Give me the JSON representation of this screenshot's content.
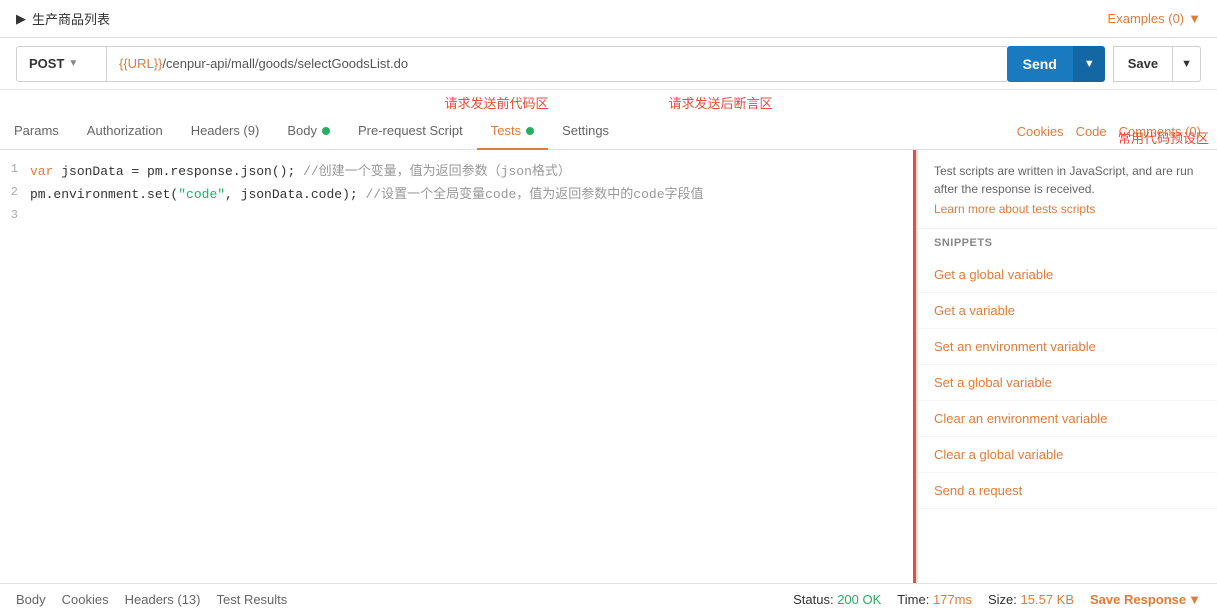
{
  "topbar": {
    "title": "生产商品列表",
    "arrow": "▶",
    "examples_label": "Examples (0)",
    "examples_chevron": "▼"
  },
  "urlbar": {
    "method": "POST",
    "method_chevron": "▼",
    "url": "{{URL}}/cenpur-api/mall/goods/selectGoodsList.do",
    "url_prefix": "{{URL}}",
    "url_suffix": "/cenpur-api/mall/goods/selectGoodsList.do",
    "send_label": "Send",
    "send_chevron": "▼",
    "save_label": "Save",
    "save_chevron": "▼"
  },
  "annotations": {
    "pre_request": "请求发送前代码区",
    "post_response": "请求发送后断言区",
    "snippets_area": "常用代码预设区"
  },
  "tabs": {
    "items": [
      {
        "label": "Params",
        "active": false,
        "has_dot": false,
        "dot_color": ""
      },
      {
        "label": "Authorization",
        "active": false,
        "has_dot": false,
        "dot_color": ""
      },
      {
        "label": "Headers (9)",
        "active": false,
        "has_dot": false,
        "dot_color": ""
      },
      {
        "label": "Body",
        "active": false,
        "has_dot": true,
        "dot_color": "green"
      },
      {
        "label": "Pre-request Script",
        "active": false,
        "has_dot": false,
        "dot_color": ""
      },
      {
        "label": "Tests",
        "active": true,
        "has_dot": true,
        "dot_color": "green"
      },
      {
        "label": "Settings",
        "active": false,
        "has_dot": false,
        "dot_color": ""
      }
    ],
    "right_links": [
      {
        "label": "Cookies"
      },
      {
        "label": "Code"
      },
      {
        "label": "Comments (0)"
      }
    ]
  },
  "code": {
    "lines": [
      {
        "num": "1",
        "parts": [
          {
            "type": "kw-var",
            "text": "var "
          },
          {
            "type": "normal",
            "text": "jsonData = pm.response.json(); //创建一个变量，值为返回参数（json格式）"
          }
        ]
      },
      {
        "num": "2",
        "parts": [
          {
            "type": "normal",
            "text": "pm.environment.set("
          },
          {
            "type": "str",
            "text": "\"code\""
          },
          {
            "type": "normal",
            "text": ", jsonData.code); //设置一个全局变量code，值为返回参数中的code字段值"
          }
        ]
      },
      {
        "num": "3",
        "parts": []
      }
    ]
  },
  "snippets": {
    "description": "Test scripts are written in JavaScript, and are run after the response is received.",
    "learn_more": "Learn more about tests scripts",
    "title": "SNIPPETS",
    "items": [
      "Get a global variable",
      "Get a variable",
      "Set an environment variable",
      "Set a global variable",
      "Clear an environment variable",
      "Clear a global variable",
      "Send a request"
    ]
  },
  "statusbar": {
    "left_tabs": [
      "Body",
      "Cookies",
      "Headers (13)",
      "Test Results"
    ],
    "status_label": "Status:",
    "status_value": "200 OK",
    "time_label": "Time:",
    "time_value": "177ms",
    "size_label": "Size:",
    "size_value": "15.57 KB",
    "save_response": "Save Response",
    "save_chevron": "▼"
  }
}
